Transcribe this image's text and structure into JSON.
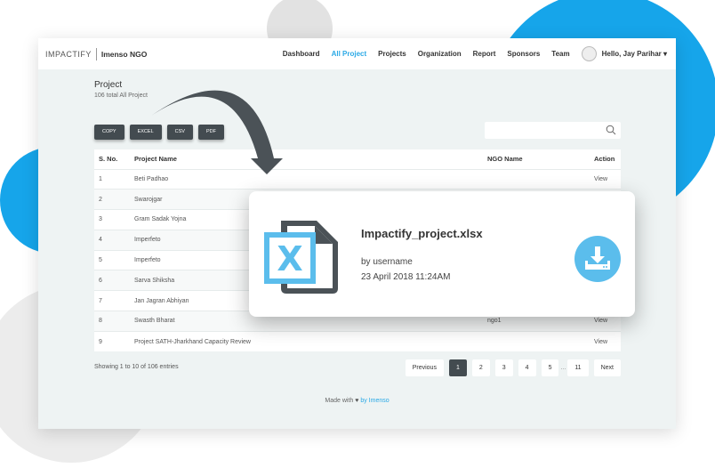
{
  "header": {
    "logo": "IMPACTIFY",
    "org": "Imenso NGO",
    "nav": [
      "Dashboard",
      "All Project",
      "Projects",
      "Organization",
      "Report",
      "Sponsors",
      "Team"
    ],
    "active": "All Project",
    "user": "Hello, Jay Parihar ▾"
  },
  "page": {
    "title": "Project",
    "subtitle": "106 total All Project"
  },
  "export_buttons": [
    "COPY",
    "EXCEL",
    "CSV",
    "PDF"
  ],
  "search": {
    "placeholder": ""
  },
  "table": {
    "headers": [
      "S. No.",
      "Project Name",
      "NGO Name",
      "Action"
    ],
    "rows": [
      [
        "1",
        "Beti Padhao",
        "",
        "View"
      ],
      [
        "2",
        "Swarojgar",
        "",
        ""
      ],
      [
        "3",
        "Gram Sadak Yojna",
        "",
        ""
      ],
      [
        "4",
        "Imperfeto",
        "",
        ""
      ],
      [
        "5",
        "Imperfeto",
        "",
        ""
      ],
      [
        "6",
        "Sarva Shiksha",
        "",
        ""
      ],
      [
        "7",
        "Jan Jagran Abhiyan",
        "",
        ""
      ],
      [
        "8",
        "Swasth Bharat",
        "ngo1",
        "View"
      ],
      [
        "9",
        "Project SATH-Jharkhand Capacity Review",
        "",
        "View"
      ]
    ]
  },
  "info": "Showing 1 to 10 of 106 entries",
  "pagination": {
    "previous": "Previous",
    "pages": [
      "1",
      "2",
      "3",
      "4",
      "5"
    ],
    "dots": "...",
    "last": "11",
    "next": "Next"
  },
  "footer": {
    "made": "Made with",
    "by": "by Imenso"
  },
  "popup": {
    "filename": "Impactify_project.xlsx",
    "by": "by username",
    "date": "23 April 2018 11:24AM"
  },
  "colors": {
    "accent": "#2aa9e6",
    "dark": "#434b50"
  }
}
